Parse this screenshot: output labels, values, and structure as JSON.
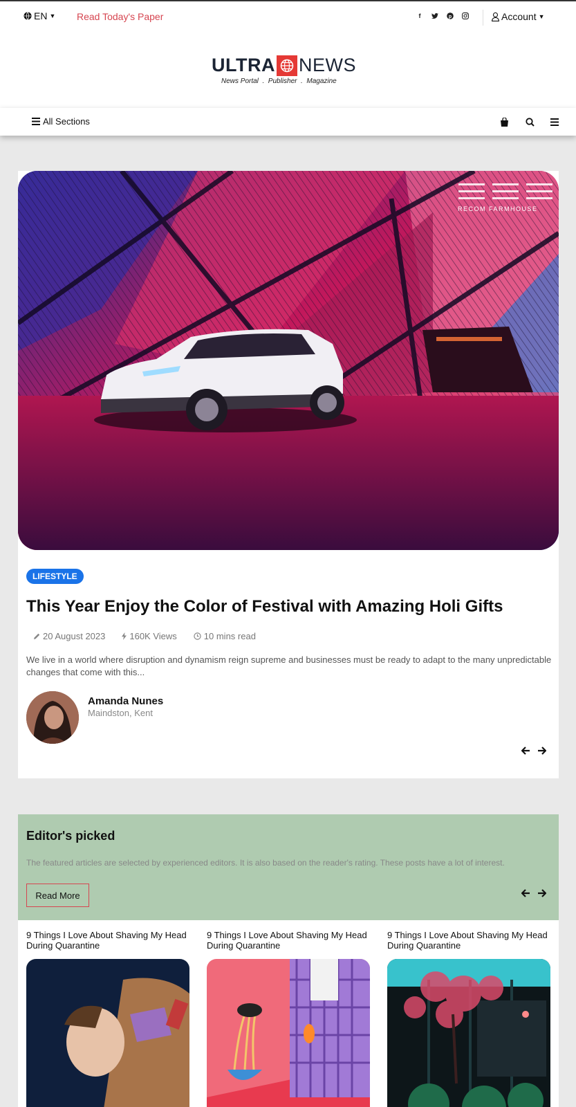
{
  "topbar": {
    "language": "EN",
    "read_paper": "Read Today's Paper",
    "account": "Account",
    "socials": [
      "facebook-icon",
      "twitter-icon",
      "pinterest-icon",
      "instagram-icon"
    ]
  },
  "logo": {
    "ultra": "ULTRA",
    "news": "NEWS",
    "tagline": "News Portal  .  Publisher  .  Magazine",
    "accent": "#e53935"
  },
  "nav": {
    "all_sections": "All Sections",
    "icons": [
      "shopping-bag-icon",
      "search-icon",
      "menu-icon"
    ]
  },
  "feature": {
    "hero_watermark": "RECOM FARMHOUSE",
    "category": "LIFESTYLE",
    "title": "This Year Enjoy the Color of Festival with Amazing Holi Gifts",
    "date": "20 August 2023",
    "views": "160K Views",
    "read_time": "10 mins read",
    "excerpt": "We live in a world where disruption and dynamism reign supreme and businesses must be ready to adapt to the many unpredictable changes that come with this...",
    "author_name": "Amanda Nunes",
    "author_location": "Maindston, Kent"
  },
  "editors": {
    "title": "Editor's picked",
    "description": "The featured articles are selected by experienced editors. It is also based on the reader's rating. These posts have a lot of interest.",
    "read_more": "Read More",
    "background": "#afcbb0"
  },
  "picks": [
    {
      "title": "9 Things I Love About Shaving My Head During Quarantine"
    },
    {
      "title": "9 Things I Love About Shaving My Head During Quarantine"
    },
    {
      "title": "9 Things I Love About Shaving My Head During Quarantine"
    }
  ],
  "colors": {
    "link_red": "#d64550",
    "tag_blue": "#1a73e8"
  }
}
